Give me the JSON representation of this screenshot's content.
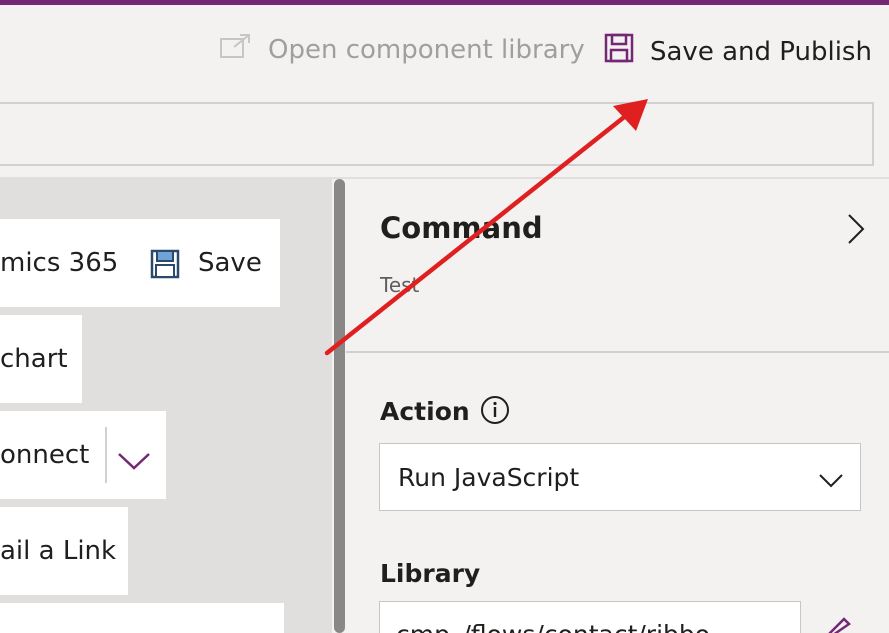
{
  "header": {
    "open_component_library_label": "Open component library",
    "save_and_publish_label": "Save and Publish"
  },
  "canvas": {
    "buttons": [
      {
        "label": "mics 365",
        "secondary_label": "Save"
      },
      {
        "label": "chart"
      },
      {
        "label": "onnect"
      },
      {
        "label": "ail a Link"
      }
    ]
  },
  "panel": {
    "title": "Command",
    "subtitle": "Test",
    "action_label": "Action",
    "action_value": "Run JavaScript",
    "library_label": "Library",
    "library_value": "cmp_/flows/contact/ribbo"
  },
  "colors": {
    "brand": "#742774",
    "annotation_arrow": "#e02020"
  }
}
